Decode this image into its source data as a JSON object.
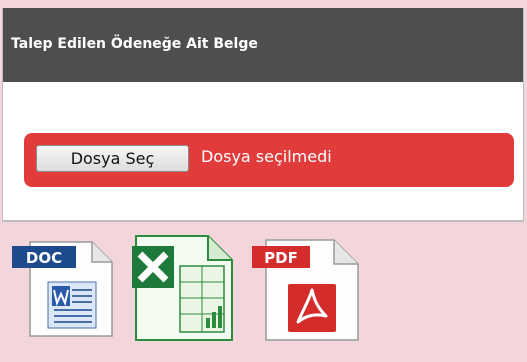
{
  "panel": {
    "title": "Talep Edilen Ödeneğe Ait Belge"
  },
  "file_input": {
    "button_label": "Dosya Seç",
    "status_text": "Dosya seçilmedi"
  },
  "file_type_icons": {
    "doc_label": "DOC",
    "pdf_label": "PDF"
  },
  "colors": {
    "header": "#4e4e4e",
    "error_row": "#e23b3b",
    "page_bg": "#f2d6dc",
    "doc_badge": "#1c4a8c",
    "pdf_badge": "#d42b2b",
    "excel_green": "#1d7a3a"
  }
}
